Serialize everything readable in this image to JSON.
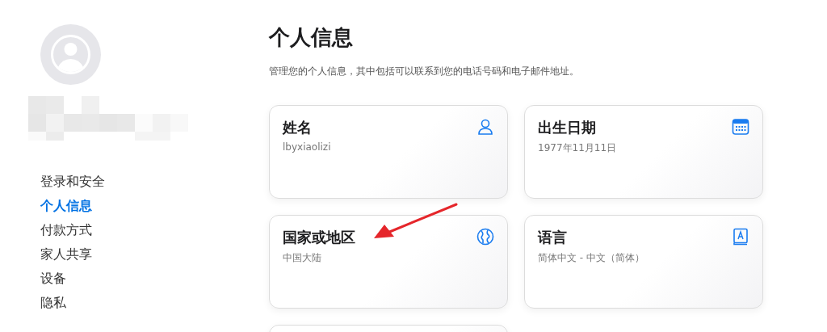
{
  "sidebar": {
    "items": [
      {
        "label": "登录和安全",
        "selected": false
      },
      {
        "label": "个人信息",
        "selected": true
      },
      {
        "label": "付款方式",
        "selected": false
      },
      {
        "label": "家人共享",
        "selected": false
      },
      {
        "label": "设备",
        "selected": false
      },
      {
        "label": "隐私",
        "selected": false
      }
    ]
  },
  "page": {
    "title": "个人信息",
    "subtitle": "管理您的个人信息，其中包括可以联系到您的电话号码和电子邮件地址。"
  },
  "cards": [
    {
      "title": "姓名",
      "value": "lbyxiaolizi",
      "kind": "person"
    },
    {
      "title": "出生日期",
      "value": "1977年11月11日",
      "kind": "calendar"
    },
    {
      "title": "国家或地区",
      "value": "中国大陆",
      "kind": "globe"
    },
    {
      "title": "语言",
      "value": "简体中文 - 中文（简体）",
      "kind": "book"
    }
  ]
}
